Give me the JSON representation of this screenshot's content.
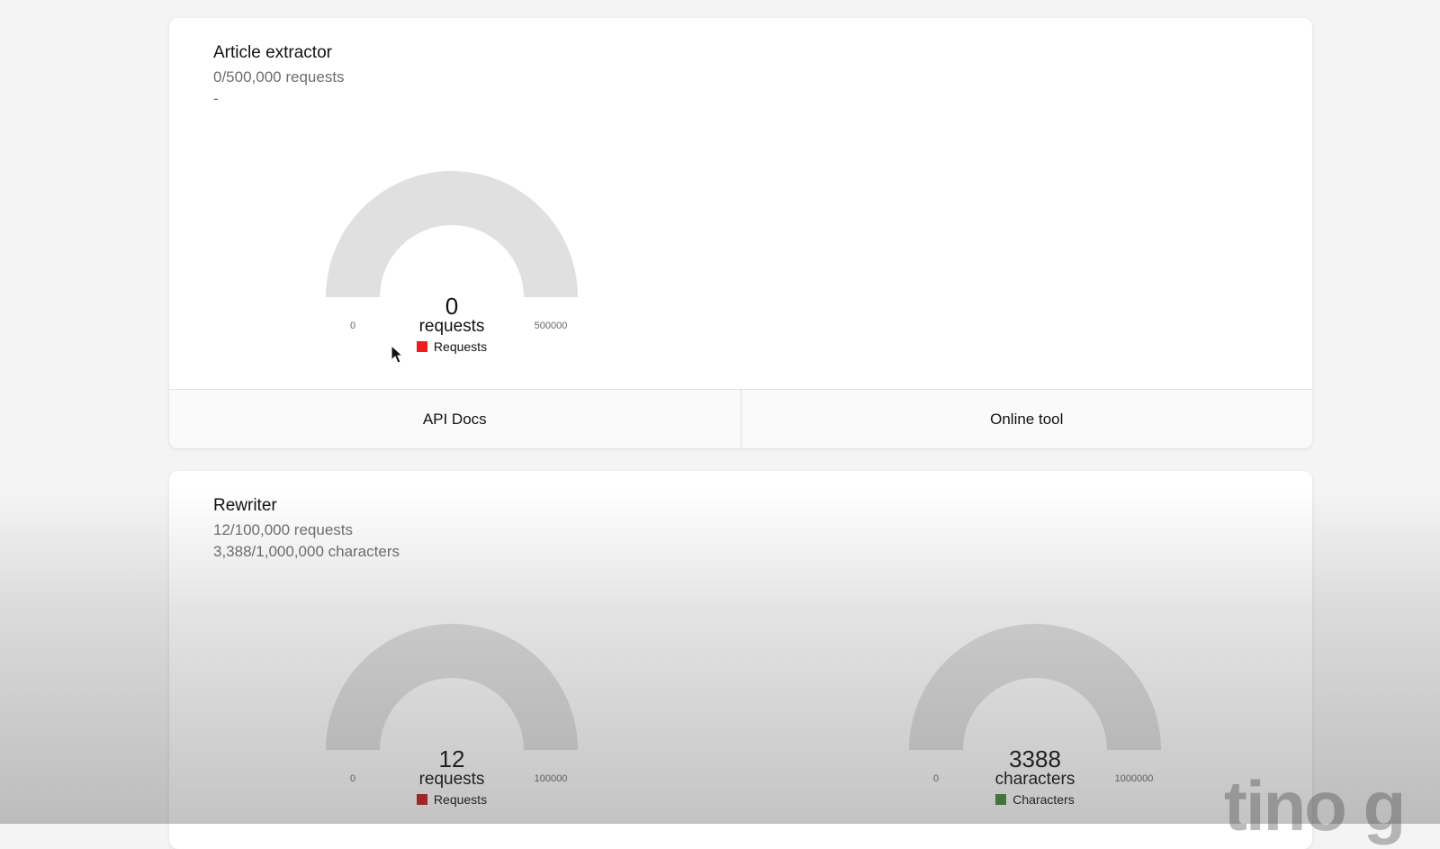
{
  "cards": [
    {
      "title": "Article extractor",
      "lines": [
        "0/500,000 requests",
        "-"
      ],
      "gauges": [
        {
          "value": "0",
          "unit": "requests",
          "min": "0",
          "max": "500000",
          "legend": "Requests",
          "color": "#ee1c1c",
          "fraction": 0
        }
      ],
      "actions": [
        "API Docs",
        "Online tool"
      ]
    },
    {
      "title": "Rewriter",
      "lines": [
        "12/100,000 requests",
        "3,388/1,000,000 characters"
      ],
      "gauges": [
        {
          "value": "12",
          "unit": "requests",
          "min": "0",
          "max": "100000",
          "legend": "Requests",
          "color": "#c21a1a",
          "fraction": 0.00012
        },
        {
          "value": "3388",
          "unit": "characters",
          "min": "0",
          "max": "1000000",
          "legend": "Characters",
          "color": "#3c8a34",
          "fraction": 0.003388
        }
      ]
    }
  ],
  "watermark": "tino g",
  "colors": {
    "gauge_track": "#e0e0e0",
    "background": "#f4f4f4"
  }
}
